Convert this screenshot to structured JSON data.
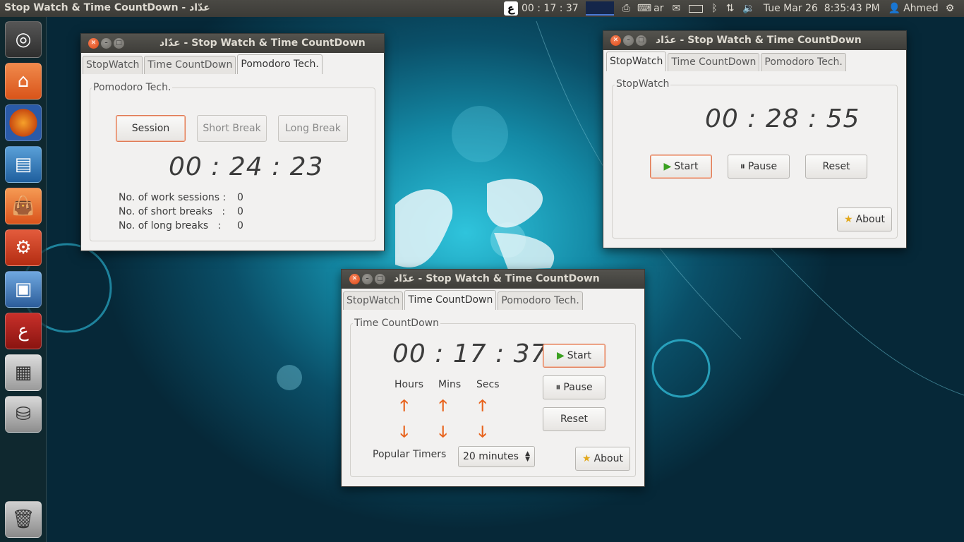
{
  "topbar": {
    "active_app": "Stop Watch & Time CountDown - عدّاد",
    "tray_time": "00 : 17 : 37",
    "keyboard_layout": "ar",
    "clock": "Tue Mar 26  8:35:43 PM",
    "user": "Ahmed",
    "icons": [
      "app-indicator-icon",
      "graph-icon",
      "printer-icon",
      "keyboard-icon",
      "mail-icon",
      "battery-icon",
      "bluetooth-icon",
      "network-icon",
      "volume-icon",
      "user-icon",
      "gear-icon"
    ]
  },
  "launcher": {
    "items": [
      "ubuntu-logo",
      "home-folder",
      "firefox",
      "libreoffice-writer",
      "software-center",
      "system-settings",
      "virtualbox",
      "adad-app",
      "workspace-switcher",
      "disk-drive",
      "trash"
    ]
  },
  "win1": {
    "title": "عدّاد - Stop Watch & Time CountDown",
    "tabs": [
      "StopWatch",
      "Time CountDown",
      "Pomodoro Tech."
    ],
    "frame_label": "Pomodoro Tech.",
    "btn_session": "Session",
    "btn_short": "Short Break",
    "btn_long": "Long Break",
    "time": "00 : 24 : 23",
    "stats": [
      {
        "label": "No. of work sessions :",
        "value": "0"
      },
      {
        "label": "No. of short breaks   :",
        "value": "0"
      },
      {
        "label": "No. of long breaks   :",
        "value": "0"
      }
    ]
  },
  "win2": {
    "title": "عدّاد - Stop Watch & Time CountDown",
    "tabs": [
      "StopWatch",
      "Time CountDown",
      "Pomodoro Tech."
    ],
    "frame_label": "StopWatch",
    "time": "00 : 28 : 55",
    "start": "Start",
    "pause": "Pause",
    "reset": "Reset",
    "about": "About"
  },
  "win3": {
    "title": "عدّاد - Stop Watch & Time CountDown",
    "tabs": [
      "StopWatch",
      "Time CountDown",
      "Pomodoro Tech."
    ],
    "frame_label": "Time CountDown",
    "time": "00 : 17 : 37",
    "hours": "Hours",
    "mins": "Mins",
    "secs": "Secs",
    "start": "Start",
    "pause": "Pause",
    "reset": "Reset",
    "about": "About",
    "popular_label": "Popular Timers",
    "popular_value": "20 minutes"
  },
  "colors": {
    "accent": "#dd4814",
    "panel": "#3c3b37",
    "window_bg": "#f2f1f0",
    "arrow": "#e8641e"
  }
}
